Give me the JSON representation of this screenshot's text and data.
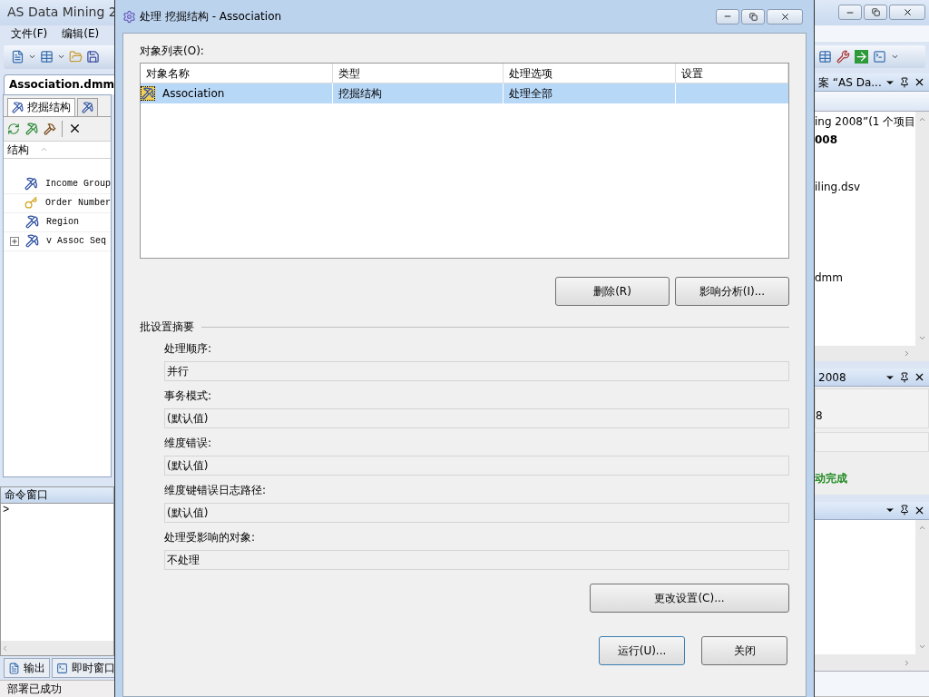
{
  "main_window": {
    "title": "AS Data Mining 2",
    "menu": [
      "文件(F)",
      "编辑(E)"
    ],
    "document_tab": "Association.dmm",
    "designer_tabs": [
      {
        "label": "挖掘结构",
        "selected": true
      },
      {
        "selected": false
      }
    ],
    "tree_header": "结构",
    "tree": [
      {
        "label": "Income Group",
        "kind": "column",
        "collapsed": false
      },
      {
        "label": "Order Number",
        "kind": "key",
        "collapsed": false
      },
      {
        "label": "Region",
        "kind": "column",
        "collapsed": false
      },
      {
        "label": "v Assoc Seq",
        "kind": "column",
        "collapsed": true
      }
    ],
    "command_window": {
      "title": "命令窗口",
      "prompt": ">"
    },
    "bottom_tabs": [
      {
        "label": "输出",
        "kind": "output"
      },
      {
        "label": "即时窗口",
        "kind": "immediate"
      }
    ],
    "status": "部署已成功"
  },
  "solution_explorer": {
    "title": "案 “AS Da...",
    "lines": [
      {
        "text": "ing 2008”(1 个项目",
        "bold": false
      },
      {
        "text": "008",
        "bold": true
      },
      {
        "text": "iling.dsv",
        "bold": false
      },
      {
        "text": "dmm",
        "bold": false
      }
    ]
  },
  "properties": {
    "title": "2008",
    "value": "8",
    "message": "动完成"
  },
  "dialog": {
    "title": "处理 挖掘结构 - Association",
    "list_label": "对象列表(O):",
    "columns": [
      "对象名称",
      "类型",
      "处理选项",
      "设置"
    ],
    "rows": [
      {
        "cells": [
          "Association",
          "挖掘结构",
          "处理全部"
        ],
        "selected": true
      }
    ],
    "list_buttons": [
      "删除(R)",
      "影响分析(I)..."
    ],
    "section_title": "批设置摘要",
    "settings": [
      {
        "label": "处理顺序:",
        "value": "并行"
      },
      {
        "label": "事务模式:",
        "value": "(默认值)"
      },
      {
        "label": "维度错误:",
        "value": "(默认值)"
      },
      {
        "label": "维度键错误日志路径:",
        "value": "(默认值)"
      },
      {
        "label": "处理受影响的对象:",
        "value": "不处理"
      }
    ],
    "change_button": "更改设置(C)...",
    "footer_buttons": [
      {
        "label": "运行(U)...",
        "default": true
      },
      {
        "label": "关闭",
        "default": false
      }
    ]
  }
}
